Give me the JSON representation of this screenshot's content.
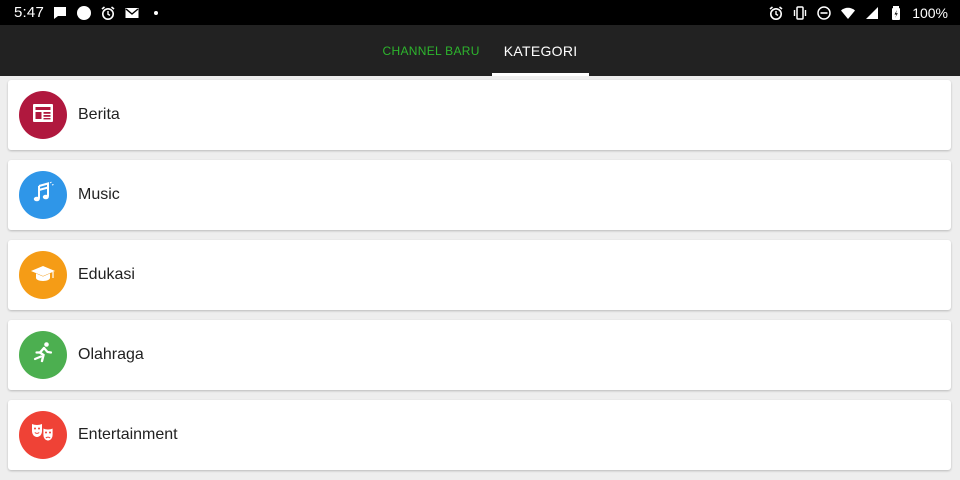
{
  "status_bar": {
    "time": "5:47",
    "battery": "100%",
    "left_icons": [
      "chat-icon",
      "circle-icon",
      "alarm-icon",
      "mail-icon",
      "dot-icon"
    ],
    "right_icons": [
      "alarm-icon",
      "vibrate-icon",
      "dnd-icon",
      "wifi-icon",
      "signal-icon",
      "battery-icon"
    ]
  },
  "tabs": [
    {
      "label": "CHANNEL BARU",
      "color": "#2db52d",
      "selected": false
    },
    {
      "label": "KATEGORI",
      "color": "#ffffff",
      "selected": true
    }
  ],
  "categories": [
    {
      "label": "Berita",
      "icon": "newspaper-icon",
      "color": "#b0183e"
    },
    {
      "label": "Music",
      "icon": "music-note-icon",
      "color": "#2f96e8"
    },
    {
      "label": "Edukasi",
      "icon": "graduation-cap-icon",
      "color": "#f59c16"
    },
    {
      "label": "Olahraga",
      "icon": "running-icon",
      "color": "#4caf50"
    },
    {
      "label": "Entertainment",
      "icon": "theater-masks-icon",
      "color": "#ef4236"
    }
  ]
}
